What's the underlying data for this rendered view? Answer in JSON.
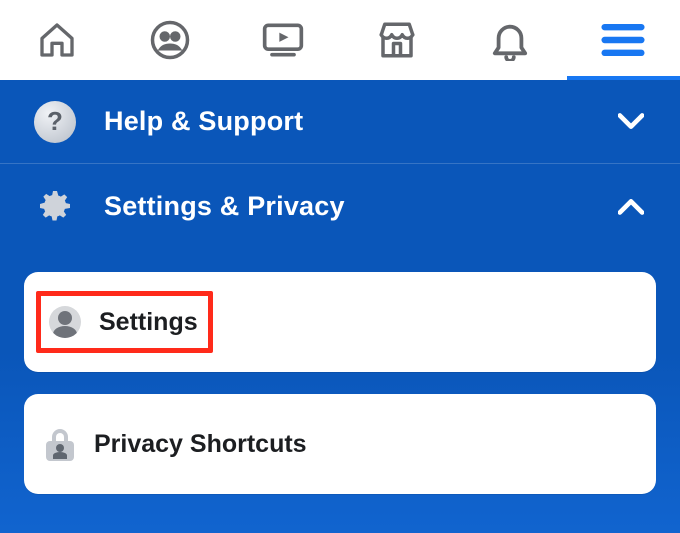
{
  "menu": {
    "help_support": "Help & Support",
    "settings_privacy": "Settings & Privacy"
  },
  "submenu": {
    "settings": "Settings",
    "privacy_shortcuts": "Privacy Shortcuts"
  },
  "colors": {
    "accent": "#1877f2",
    "panel": "#0a56b9"
  }
}
